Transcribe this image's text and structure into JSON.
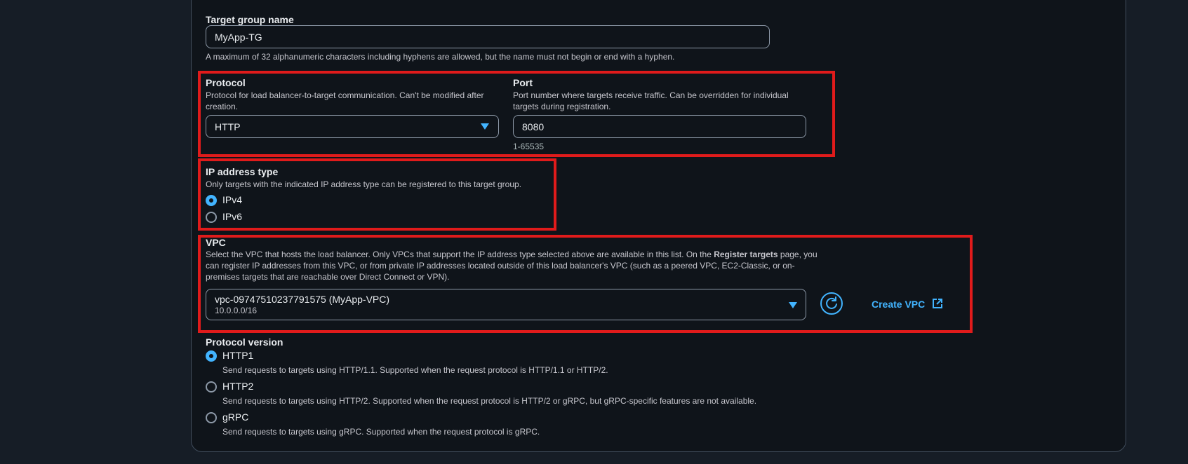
{
  "target_group_name": {
    "label": "Target group name",
    "value": "MyApp-TG",
    "hint": "A maximum of 32 alphanumeric characters including hyphens are allowed, but the name must not begin or end with a hyphen."
  },
  "protocol": {
    "label": "Protocol",
    "description": "Protocol for load balancer-to-target communication. Can't be modified after creation.",
    "selected": "HTTP"
  },
  "port": {
    "label": "Port",
    "description": "Port number where targets receive traffic. Can be overridden for individual targets during registration.",
    "value": "8080",
    "hint": "1-65535"
  },
  "ip_address_type": {
    "label": "IP address type",
    "description": "Only targets with the indicated IP address type can be registered to this target group.",
    "options": [
      {
        "label": "IPv4",
        "checked": true
      },
      {
        "label": "IPv6",
        "checked": false
      }
    ]
  },
  "vpc": {
    "label": "VPC",
    "description_part1": "Select the VPC that hosts the load balancer. Only VPCs that support the IP address type selected above are available in this list. On the ",
    "description_bold": "Register targets",
    "description_part2": " page, you can register IP addresses from this VPC, or from private IP addresses located outside of this load balancer's VPC (such as a peered VPC, EC2-Classic, or on-premises targets that are reachable over Direct Connect or VPN).",
    "selected_name": "vpc-09747510237791575 (MyApp-VPC)",
    "selected_cidr": "10.0.0.0/16",
    "create_link": "Create VPC"
  },
  "protocol_version": {
    "label": "Protocol version",
    "options": [
      {
        "label": "HTTP1",
        "description": "Send requests to targets using HTTP/1.1. Supported when the request protocol is HTTP/1.1 or HTTP/2.",
        "checked": true
      },
      {
        "label": "HTTP2",
        "description": "Send requests to targets using HTTP/2. Supported when the request protocol is HTTP/2 or gRPC, but gRPC-specific features are not available.",
        "checked": false
      },
      {
        "label": "gRPC",
        "description": "Send requests to targets using gRPC. Supported when the request protocol is gRPC.",
        "checked": false
      }
    ]
  },
  "colors": {
    "background": "#161d26",
    "card": "#0f141a",
    "accent": "#42b4ff",
    "highlight": "#e01b1b",
    "border": "#8d99a8"
  }
}
